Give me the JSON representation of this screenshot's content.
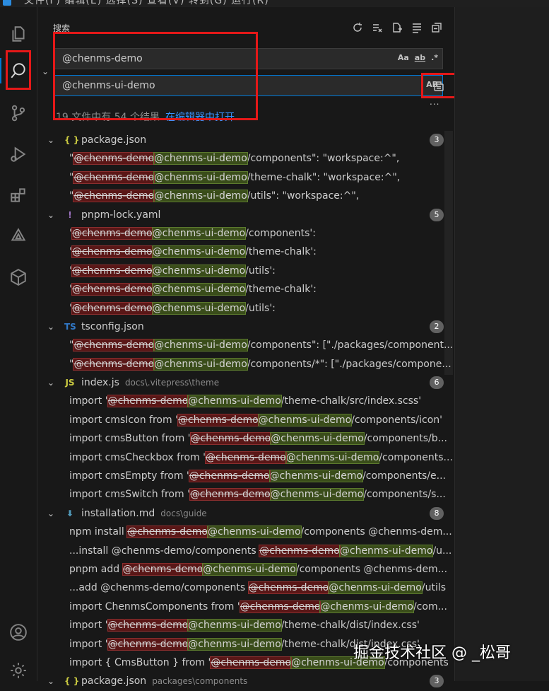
{
  "menu": "文件(F)   编辑(E)   选择(S)   查看(V)   转到(G)   运行(R)",
  "search_panel": {
    "title": "搜索",
    "search_value": "@chenms-demo",
    "replace_value": "@chenms-ui-demo",
    "opt_case": "Aa",
    "opt_word": "ab",
    "opt_regex": ".*",
    "opt_preserve_case": "AB",
    "more": "...",
    "summary": "19 文件中有 54 个结果",
    "open_in_editor": "在编辑器中打开"
  },
  "results": [
    {
      "name": "package.json",
      "dir": "",
      "icon": "{ }",
      "icon_color": "#cbcb41",
      "count": "3",
      "matches": [
        {
          "pre": "\"",
          "old": "@chenms-demo",
          "new": "@chenms-ui-demo",
          "post": "/components\": \"workspace:^\","
        },
        {
          "pre": "\"",
          "old": "@chenms-demo",
          "new": "@chenms-ui-demo",
          "post": "/theme-chalk\": \"workspace:^\","
        },
        {
          "pre": "\"",
          "old": "@chenms-demo",
          "new": "@chenms-ui-demo",
          "post": "/utils\": \"workspace:^\","
        }
      ]
    },
    {
      "name": "pnpm-lock.yaml",
      "dir": "",
      "icon": "!",
      "icon_color": "#a074c4",
      "count": "5",
      "matches": [
        {
          "pre": "'",
          "old": "@chenms-demo",
          "new": "@chenms-ui-demo",
          "post": "/components':"
        },
        {
          "pre": "'",
          "old": "@chenms-demo",
          "new": "@chenms-ui-demo",
          "post": "/theme-chalk':"
        },
        {
          "pre": "'",
          "old": "@chenms-demo",
          "new": "@chenms-ui-demo",
          "post": "/utils':"
        },
        {
          "pre": "'",
          "old": "@chenms-demo",
          "new": "@chenms-ui-demo",
          "post": "/theme-chalk':"
        },
        {
          "pre": "'",
          "old": "@chenms-demo",
          "new": "@chenms-ui-demo",
          "post": "/utils':"
        }
      ]
    },
    {
      "name": "tsconfig.json",
      "dir": "",
      "icon": "TS",
      "icon_color": "#3178c6",
      "count": "2",
      "matches": [
        {
          "pre": "\"",
          "old": "@chenms-demo",
          "new": "@chenms-ui-demo",
          "post": "/components\": [\"./packages/component..."
        },
        {
          "pre": "\"",
          "old": "@chenms-demo",
          "new": "@chenms-ui-demo",
          "post": "/components/*\": [\"./packages/compone..."
        }
      ]
    },
    {
      "name": "index.js",
      "dir": "docs\\.vitepress\\theme",
      "icon": "JS",
      "icon_color": "#cbcb41",
      "count": "6",
      "matches": [
        {
          "pre": "import '",
          "old": "@chenms-demo",
          "new": "@chenms-ui-demo",
          "post": "/theme-chalk/src/index.scss'"
        },
        {
          "pre": "import cmsIcon from '",
          "old": "@chenms-demo",
          "new": "@chenms-ui-demo",
          "post": "/components/icon'"
        },
        {
          "pre": "import cmsButton from '",
          "old": "@chenms-demo",
          "new": "@chenms-ui-demo",
          "post": "/components/b..."
        },
        {
          "pre": "import cmsCheckbox from '",
          "old": "@chenms-demo",
          "new": "@chenms-ui-demo",
          "post": "/components..."
        },
        {
          "pre": "import cmsEmpty from '",
          "old": "@chenms-demo",
          "new": "@chenms-ui-demo",
          "post": "/components/e..."
        },
        {
          "pre": "import cmsSwitch from '",
          "old": "@chenms-demo",
          "new": "@chenms-ui-demo",
          "post": "/components/s..."
        }
      ]
    },
    {
      "name": "installation.md",
      "dir": "docs\\guide",
      "icon": "⬇",
      "icon_color": "#519aba",
      "count": "8",
      "matches": [
        {
          "pre": "npm install ",
          "old": "@chenms-demo",
          "new": "@chenms-ui-demo",
          "post": "/components @chenms-dem..."
        },
        {
          "pre": "...install @chenms-demo/components ",
          "old": "@chenms-demo",
          "new": "@chenms-ui-demo",
          "post": "/u..."
        },
        {
          "pre": "pnpm add ",
          "old": "@chenms-demo",
          "new": "@chenms-ui-demo",
          "post": "/components @chenms-dem..."
        },
        {
          "pre": "...add @chenms-demo/components ",
          "old": "@chenms-demo",
          "new": "@chenms-ui-demo",
          "post": "/utils"
        },
        {
          "pre": "import ChenmsComponents from '",
          "old": "@chenms-demo",
          "new": "@chenms-ui-demo",
          "post": "/com..."
        },
        {
          "pre": "import '",
          "old": "@chenms-demo",
          "new": "@chenms-ui-demo",
          "post": "/theme-chalk/dist/index.css'"
        },
        {
          "pre": "import '",
          "old": "@chenms-demo",
          "new": "@chenms-ui-demo",
          "post": "/theme-chalk/dist/index.css'"
        },
        {
          "pre": "import { CmsButton } from '",
          "old": "@chenms-demo",
          "new": "@chenms-ui-demo",
          "post": "/components"
        }
      ]
    },
    {
      "name": "package.json",
      "dir": "packages\\components",
      "icon": "{ }",
      "icon_color": "#cbcb41",
      "count": "3",
      "matches": []
    }
  ],
  "watermark": "掘金技术社区 @ _松哥"
}
